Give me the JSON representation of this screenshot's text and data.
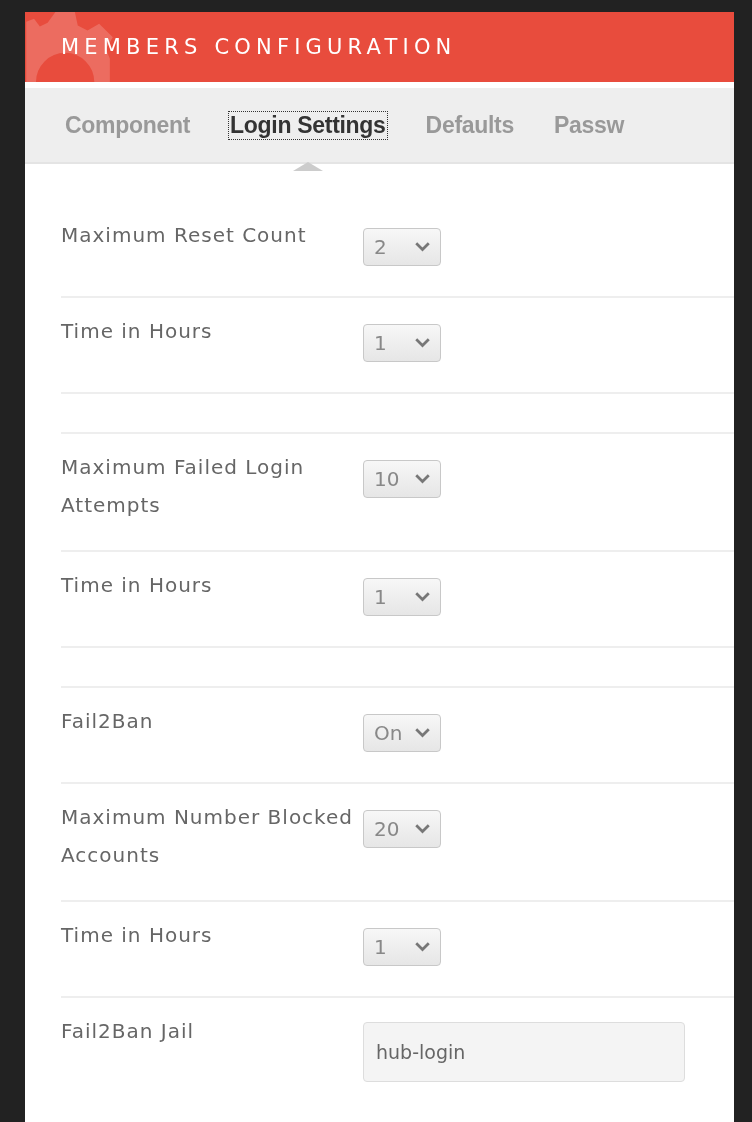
{
  "header": {
    "title": "MEMBERS CONFIGURATION"
  },
  "tabs": [
    {
      "label": "Component",
      "selected": false
    },
    {
      "label": "Login Settings",
      "selected": true
    },
    {
      "label": "Defaults",
      "selected": false
    },
    {
      "label": "Passw",
      "selected": false
    }
  ],
  "rows": [
    {
      "kind": "select",
      "label": "Maximum Reset Count",
      "value": "2"
    },
    {
      "kind": "select",
      "label": "Time in Hours",
      "value": "1"
    },
    {
      "kind": "spacer"
    },
    {
      "kind": "select",
      "label": "Maximum Failed Login Attempts",
      "value": "10"
    },
    {
      "kind": "select",
      "label": "Time in Hours",
      "value": "1"
    },
    {
      "kind": "spacer"
    },
    {
      "kind": "select",
      "label": "Fail2Ban",
      "value": "On"
    },
    {
      "kind": "select",
      "label": "Maximum Number Blocked Accounts",
      "value": "20"
    },
    {
      "kind": "select",
      "label": "Time in Hours",
      "value": "1"
    },
    {
      "kind": "text",
      "label": "Fail2Ban Jail",
      "value": "hub-login"
    }
  ]
}
